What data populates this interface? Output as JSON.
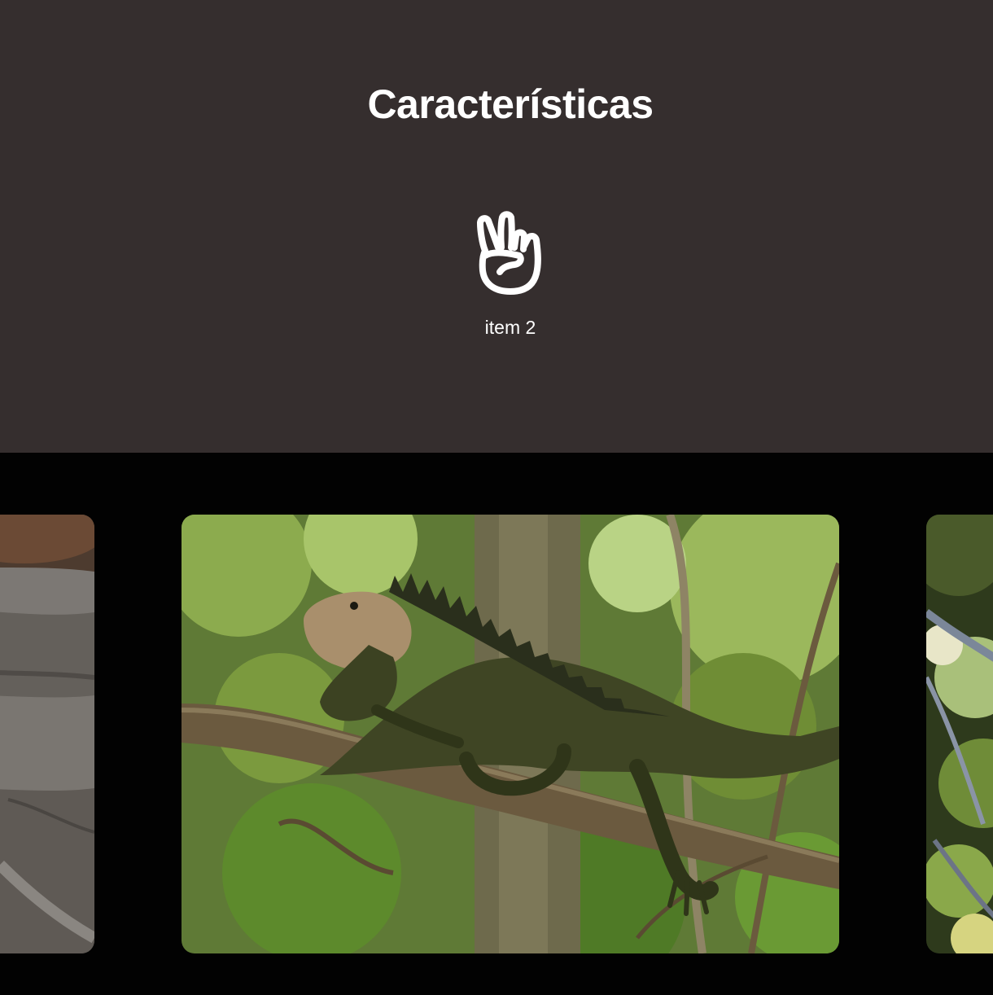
{
  "features": {
    "title": "Características",
    "items": [
      {
        "icon": "peace-hand-icon",
        "label": "item 2"
      }
    ]
  },
  "gallery": {
    "slides": [
      {
        "name": "rocks-photo",
        "position": "previous"
      },
      {
        "name": "iguana-on-branch-photo",
        "position": "current"
      },
      {
        "name": "forest-photo",
        "position": "next"
      }
    ]
  },
  "colors": {
    "features_background": "#352e2e",
    "gallery_background": "#020202",
    "text": "#ffffff"
  }
}
